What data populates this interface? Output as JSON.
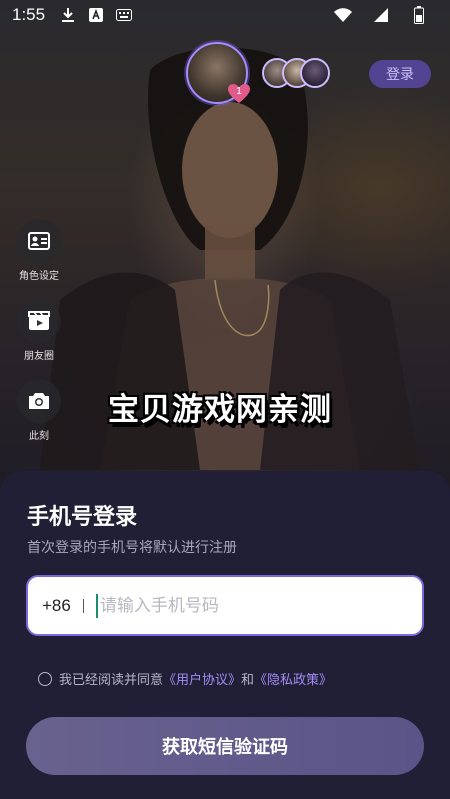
{
  "status_bar": {
    "time": "1:55",
    "icons": [
      "download-icon",
      "text-format-icon",
      "keyboard-icon",
      "wifi-icon",
      "signal-icon",
      "battery-icon"
    ]
  },
  "header": {
    "avatar_badge_count": "1",
    "login_label": "登录"
  },
  "side_menu": {
    "items": [
      {
        "label": "角色设定",
        "icon": "id-card-icon"
      },
      {
        "label": "朋友圈",
        "icon": "video-clapper-icon"
      },
      {
        "label": "此刻",
        "icon": "camera-icon"
      }
    ]
  },
  "watermark": "宝贝游戏网亲测",
  "login_sheet": {
    "title": "手机号登录",
    "subtitle": "首次登录的手机号将默认进行注册",
    "country_code": "+86",
    "phone_placeholder": "请输入手机号码",
    "phone_value": "",
    "agreement_prefix": "我已经阅读并同意",
    "user_agreement": "《用户协议》",
    "and": "和",
    "privacy_policy": "《隐私政策》",
    "sms_button": "获取短信验证码"
  },
  "colors": {
    "accent": "#7c68d8",
    "link": "#a38cf5",
    "sheet_bg": "#211f35",
    "badge": "#e05a8a"
  }
}
